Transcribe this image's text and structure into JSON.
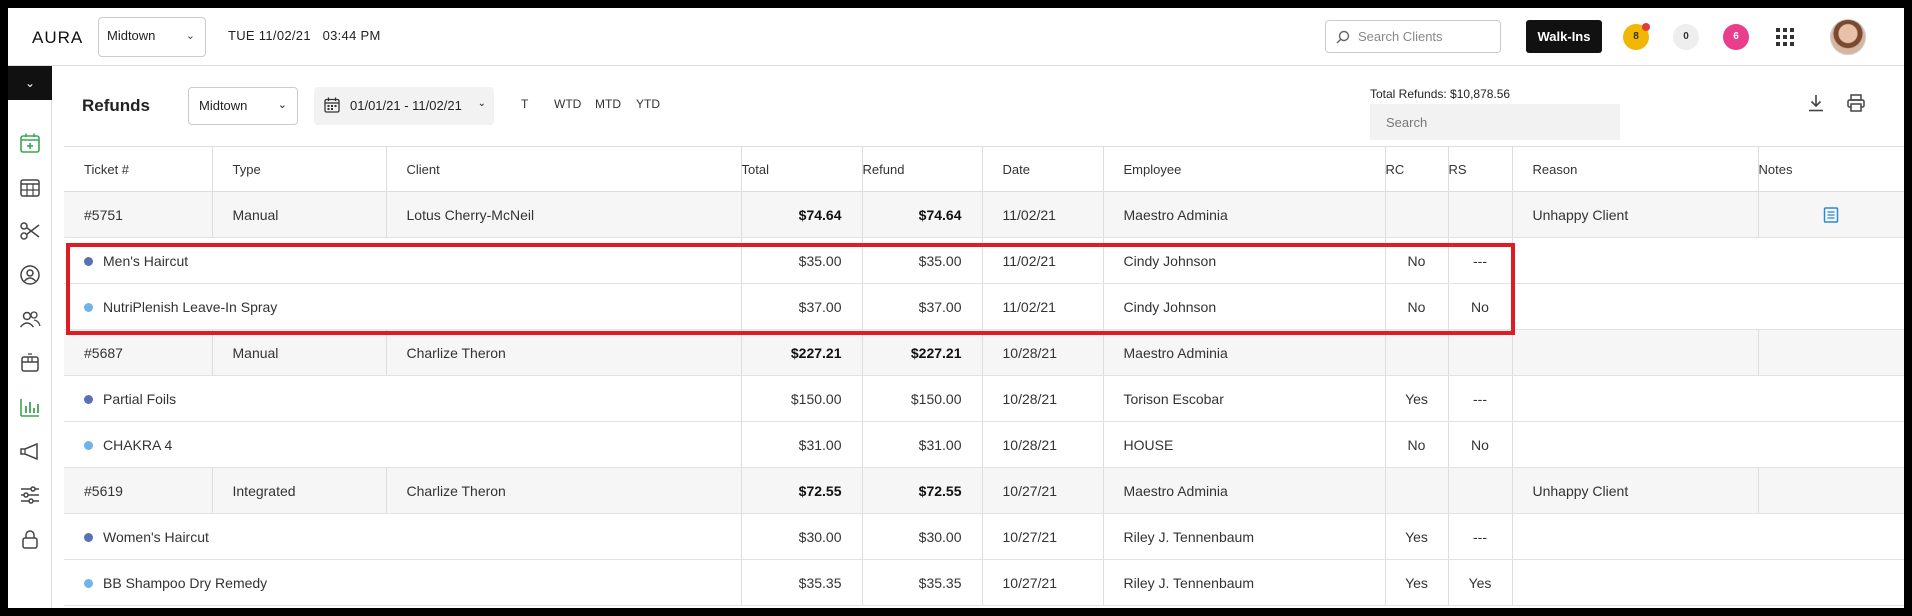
{
  "topbar": {
    "logo": "AURA",
    "location": "Midtown",
    "datetime": "TUE 11/02/21   03:44 PM",
    "search_placeholder": "Search Clients",
    "walkins_label": "Walk-Ins",
    "badges": [
      "8",
      "0",
      "6"
    ]
  },
  "header": {
    "title": "Refunds",
    "location": "Midtown",
    "date_range": "01/01/21 - 11/02/21",
    "periods": [
      "T",
      "WTD",
      "MTD",
      "YTD"
    ],
    "total_refunds": "Total Refunds: $10,878.56",
    "search_placeholder": "Search"
  },
  "table": {
    "columns": [
      "Ticket #",
      "Type",
      "Client",
      "Total",
      "Refund",
      "Date",
      "Employee",
      "RC",
      "RS",
      "Reason",
      "Notes"
    ],
    "rows": [
      {
        "kind": "parent",
        "ticket": "#5751",
        "type": "Manual",
        "client": "Lotus Cherry-McNeil",
        "total": "$74.64",
        "refund": "$74.64",
        "date": "11/02/21",
        "employee": "Maestro Adminia",
        "rc": "",
        "rs": "",
        "reason": "Unhappy Client",
        "note": true
      },
      {
        "kind": "child",
        "dot": "dark",
        "item": "Men's Haircut",
        "total": "$35.00",
        "refund": "$35.00",
        "date": "11/02/21",
        "employee": "Cindy Johnson",
        "rc": "No",
        "rs": "---"
      },
      {
        "kind": "child",
        "dot": "light",
        "item": "NutriPlenish Leave-In Spray",
        "total": "$37.00",
        "refund": "$37.00",
        "date": "11/02/21",
        "employee": "Cindy Johnson",
        "rc": "No",
        "rs": "No"
      },
      {
        "kind": "parent",
        "ticket": "#5687",
        "type": "Manual",
        "client": "Charlize Theron",
        "total": "$227.21",
        "refund": "$227.21",
        "date": "10/28/21",
        "employee": "Maestro Adminia",
        "rc": "",
        "rs": "",
        "reason": "",
        "note": false
      },
      {
        "kind": "child",
        "dot": "dark",
        "item": "Partial Foils",
        "total": "$150.00",
        "refund": "$150.00",
        "date": "10/28/21",
        "employee": "Torison Escobar",
        "rc": "Yes",
        "rs": "---"
      },
      {
        "kind": "child",
        "dot": "light",
        "item": "CHAKRA 4",
        "total": "$31.00",
        "refund": "$31.00",
        "date": "10/28/21",
        "employee": "HOUSE",
        "rc": "No",
        "rs": "No"
      },
      {
        "kind": "parent",
        "ticket": "#5619",
        "type": "Integrated",
        "client": "Charlize Theron",
        "total": "$72.55",
        "refund": "$72.55",
        "date": "10/27/21",
        "employee": "Maestro Adminia",
        "rc": "",
        "rs": "",
        "reason": "Unhappy Client",
        "note": false
      },
      {
        "kind": "child",
        "dot": "dark",
        "item": "Women's Haircut",
        "total": "$30.00",
        "refund": "$30.00",
        "date": "10/27/21",
        "employee": "Riley J. Tennenbaum",
        "rc": "Yes",
        "rs": "---"
      },
      {
        "kind": "child",
        "dot": "light",
        "item": "BB Shampoo Dry Remedy",
        "total": "$35.35",
        "refund": "$35.35",
        "date": "10/27/21",
        "employee": "Riley J. Tennenbaum",
        "rc": "Yes",
        "rs": "Yes"
      }
    ]
  },
  "colors": {
    "accent_link": "#2b8ad6",
    "highlight": "#e01b24",
    "sidebar_active": "#3aa655",
    "dot_dark": "#5b6fb5",
    "dot_light": "#6fb3ea"
  },
  "icons": {
    "sidebar": [
      "calendar-add-icon",
      "calendar-grid-icon",
      "scissors-icon",
      "user-circle-icon",
      "users-icon",
      "box-icon",
      "bar-chart-icon",
      "megaphone-icon",
      "sliders-icon",
      "lock-icon"
    ]
  }
}
